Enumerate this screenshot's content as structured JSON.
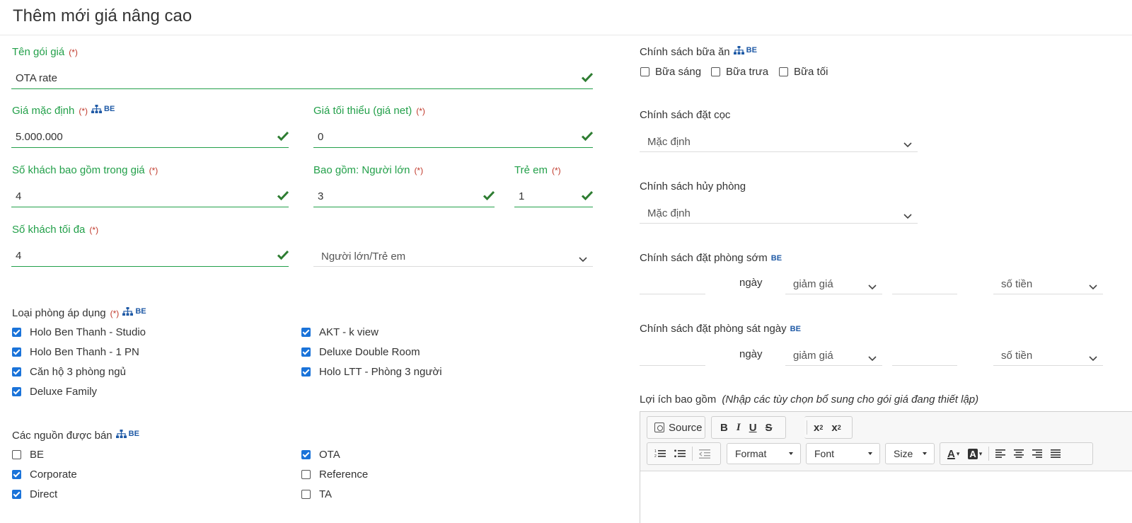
{
  "page": {
    "title": "Thêm mới giá nâng cao"
  },
  "common": {
    "required": "(*)",
    "be": "BE"
  },
  "left": {
    "package_name": {
      "label": "Tên gói giá",
      "value": "OTA rate"
    },
    "default_price": {
      "label": "Giá mặc định",
      "value": "5.000.000"
    },
    "min_price": {
      "label": "Giá tối thiểu (giá net)",
      "value": "0"
    },
    "guests_included": {
      "label": "Số khách bao gồm trong giá",
      "value": "4"
    },
    "adults": {
      "label": "Bao gồm: Người lớn",
      "value": "3"
    },
    "children": {
      "label": "Trẻ em",
      "value": "1"
    },
    "max_guests": {
      "label": "Số khách tối đa",
      "value": "4"
    },
    "guest_type_select": {
      "value": "Người lớn/Trẻ em"
    },
    "room_types": {
      "label": "Loại phòng áp dụng",
      "items": [
        {
          "label": "Holo Ben Thanh - Studio",
          "checked": true
        },
        {
          "label": "Holo Ben Thanh - 1 PN",
          "checked": true
        },
        {
          "label": "Căn hộ 3 phòng ngủ",
          "checked": true
        },
        {
          "label": "Deluxe Family",
          "checked": true
        },
        {
          "label": "AKT - k view",
          "checked": true
        },
        {
          "label": "Deluxe Double Room",
          "checked": true
        },
        {
          "label": "Holo LTT - Phòng 3 người",
          "checked": true
        }
      ]
    },
    "sources": {
      "label": "Các nguồn được bán",
      "items": [
        {
          "label": "BE",
          "checked": false
        },
        {
          "label": "Corporate",
          "checked": true
        },
        {
          "label": "Direct",
          "checked": true
        },
        {
          "label": "OTA",
          "checked": true
        },
        {
          "label": "Reference",
          "checked": false
        },
        {
          "label": "TA",
          "checked": false
        }
      ]
    }
  },
  "right": {
    "meal_policy": {
      "label": "Chính sách bữa ăn",
      "items": [
        {
          "label": "Bữa sáng",
          "checked": false
        },
        {
          "label": "Bữa trưa",
          "checked": false
        },
        {
          "label": "Bữa tối",
          "checked": false
        }
      ]
    },
    "deposit_policy": {
      "label": "Chính sách đặt cọc",
      "value": "Mặc định"
    },
    "cancel_policy": {
      "label": "Chính sách hủy phòng",
      "value": "Mặc định"
    },
    "early_booking": {
      "label": "Chính sách đặt phòng sớm",
      "days_label": "ngày",
      "discount_select": "giảm giá",
      "amount_select": "số tiền"
    },
    "late_booking": {
      "label": "Chính sách đặt phòng sát ngày",
      "days_label": "ngày",
      "discount_select": "giảm giá",
      "amount_select": "số tiền"
    },
    "benefits": {
      "label": "Lợi ích bao gồm",
      "hint": "(Nhập các tùy chọn bổ sung cho gói giá đang thiết lập)"
    },
    "editor": {
      "source": "Source",
      "bold": "B",
      "italic": "I",
      "underline": "U",
      "strike": "S",
      "subscript": "x",
      "sub_mark": "2",
      "superscript": "x",
      "sup_mark": "2",
      "format": "Format",
      "font": "Font",
      "size": "Size",
      "text_color": "A",
      "bg_color": "A"
    }
  },
  "colors": {
    "accent_green": "#23a04a",
    "required_red": "#c0392b",
    "checkbox_blue": "#1a73d9",
    "be_blue": "#1f5aa6"
  },
  "icons": {
    "valid": "check-icon",
    "dropdown": "chevron-down-icon",
    "be": "sitemap-icon"
  }
}
